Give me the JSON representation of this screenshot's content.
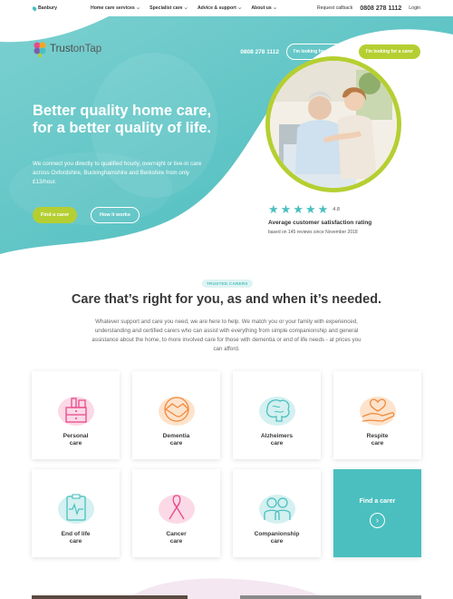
{
  "topbar": {
    "location": "Banbury",
    "menu": [
      {
        "label": "Home care services"
      },
      {
        "label": "Specialist care"
      },
      {
        "label": "Advice & support"
      },
      {
        "label": "About us"
      }
    ],
    "request_callback": "Request callback",
    "phone": "0808 278 1112",
    "login": "Login"
  },
  "header": {
    "logo_text_1": "Trust",
    "logo_text_2": "onTap",
    "phone": "0808 278 1112",
    "job_button": "I'm looking for a care job",
    "carer_button": "I'm looking for a carer"
  },
  "hero": {
    "title": "Better quality home care, for a better quality of life.",
    "intro": "We connect you directly to qualified hourly, overnight or live-in care across Oxfordshire, Buckinghamshire and Berkshire from only £13/hour.",
    "cta_find": "Find a carer",
    "cta_how": "How it works"
  },
  "rating": {
    "score": "4.8",
    "stars": 5,
    "title": "Average customer satisfaction rating",
    "subtitle": "based on 145 reviews since November 2018"
  },
  "section": {
    "tag": "TRUSTED CARERS",
    "title": "Care that’s right for you, as and when it’s needed.",
    "text": "Whatever support and care you need, we are here to help. We match you or your family with experienced, understanding and certified carers who can assist with everything from simple companionship and general assistance about the home, to more involved care for those with dementia or end of life needs - at prices you can afford."
  },
  "cards": [
    {
      "line1": "Personal",
      "line2": "care",
      "icon": "nightstand-icon"
    },
    {
      "line1": "Dementia",
      "line2": "care",
      "icon": "handshake-icon"
    },
    {
      "line1": "Alzheimers",
      "line2": "care",
      "icon": "brain-icon"
    },
    {
      "line1": "Respite",
      "line2": "care",
      "icon": "heart-hand-icon"
    },
    {
      "line1": "End of life",
      "line2": "care",
      "icon": "heart-monitor-icon"
    },
    {
      "line1": "Cancer",
      "line2": "care",
      "icon": "ribbon-icon"
    },
    {
      "line1": "Companionship",
      "line2": "care",
      "icon": "couple-icon"
    }
  ],
  "find_card": {
    "label": "Find a carer",
    "icon": "chevron-right-icon"
  },
  "colors": {
    "teal": "#4bbfbf",
    "green": "#b5cf32",
    "pink": "#e84a8a",
    "orange": "#f08a3c"
  }
}
